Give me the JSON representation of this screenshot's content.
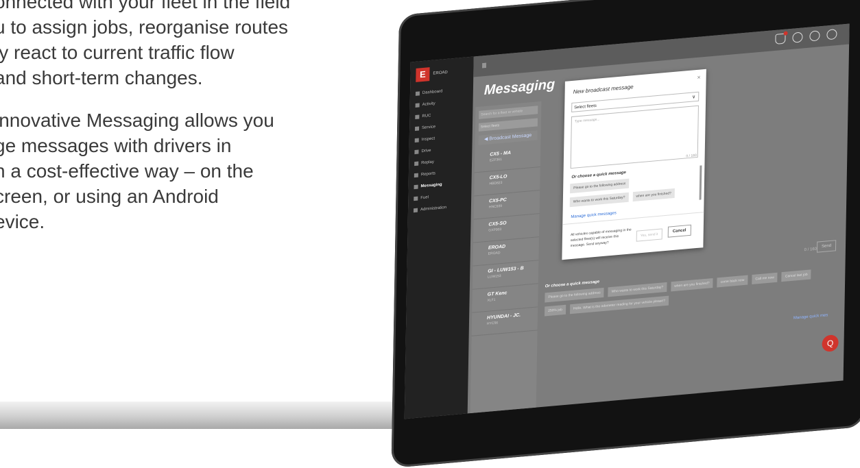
{
  "copy": {
    "line1": "onnected with your fleet in the field",
    "line2": "u to assign jobs, reorganise routes",
    "line3": "ly react to current traffic flow",
    "line4": "and short-term changes.",
    "line5": "innovative Messaging allows you",
    "line6": "ge messages with drivers in",
    "line7": "n a cost-effective way – on the",
    "line8": "creen, or using an Android",
    "line9": "evice."
  },
  "app": {
    "logo_text": "EROAD",
    "menu_label": "Ⅲ",
    "page_title": "Messaging",
    "nav": [
      {
        "label": "Dashboard"
      },
      {
        "label": "Activity"
      },
      {
        "label": "RUC"
      },
      {
        "label": "Service"
      },
      {
        "label": "Inspect"
      },
      {
        "label": "Drive"
      },
      {
        "label": "Replay"
      },
      {
        "label": "Reports"
      },
      {
        "label": "Messaging"
      },
      {
        "label": "Fuel"
      },
      {
        "label": "Administration"
      }
    ],
    "search_placeholder": "Search for a fleet or vehicle",
    "select_fleets": "Select fleets",
    "broadcast_button": "◀ Broadcast Message",
    "vehicles": [
      {
        "name": "CX5 - MA",
        "code": "EZF361"
      },
      {
        "name": "CX5-LO",
        "code": "HBD823"
      },
      {
        "name": "CX5-PC",
        "code": "HNC939"
      },
      {
        "name": "CX5-SO",
        "code": "GXP903"
      },
      {
        "name": "EROAD",
        "code": "EROAD"
      },
      {
        "name": "GI - LUW153 - B",
        "code": "LUW153"
      },
      {
        "name": "GT Kenc",
        "code": "XLF1"
      },
      {
        "name": "HYUNDAI - JC.",
        "code": "HYC56"
      }
    ],
    "bottom": {
      "count": "0 / 160",
      "send": "Send",
      "quick_label": "Or choose a quick message",
      "chips": [
        "Please go to the following address",
        "Who wants to work this Saturday?",
        "when are you finished?",
        "come back now",
        "Call me now",
        "Cancel last job",
        "250% job",
        "Hello. What is the odometer reading for your vehicle please?"
      ],
      "manage": "Manage quick mes"
    },
    "fab_icon": "Q"
  },
  "modal": {
    "close": "×",
    "title": "New broadcast message",
    "select_fleets": "Select fleets",
    "placeholder": "Type message...",
    "count": "0 / 160",
    "quick_label": "Or choose a quick message",
    "chips": [
      "Please go to the following address",
      "Who wants to work this Saturday?",
      "when are you finished?"
    ],
    "manage": "Manage quick messages",
    "warning": "All vehicles capable of messaging in the selected fleet(s) will receive this message. Send anyway?",
    "yes": "Yes, send it",
    "cancel": "Cancel"
  },
  "colors": {
    "accent": "#d0342c",
    "link": "#2f6fd8"
  }
}
